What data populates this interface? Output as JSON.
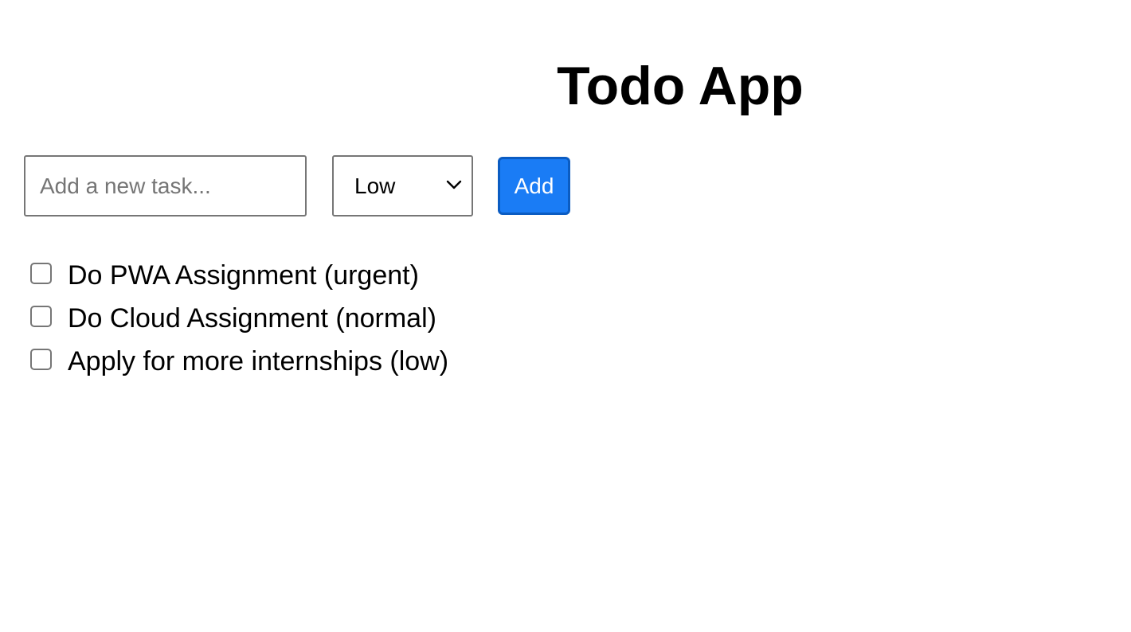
{
  "app": {
    "title": "Todo App"
  },
  "form": {
    "task_placeholder": "Add a new task...",
    "task_value": "",
    "priority_selected": "Low",
    "add_label": "Add"
  },
  "todos": [
    {
      "text": "Do PWA Assignment (urgent)",
      "checked": false
    },
    {
      "text": "Do Cloud Assignment (normal)",
      "checked": false
    },
    {
      "text": "Apply for more internships (low)",
      "checked": false
    }
  ],
  "colors": {
    "accent": "#1a7cf5",
    "accent_border": "#0b5cc2",
    "border": "#767676"
  },
  "icons": {
    "select_arrow": "chevron-down-icon",
    "checkbox": "checkbox-icon"
  }
}
